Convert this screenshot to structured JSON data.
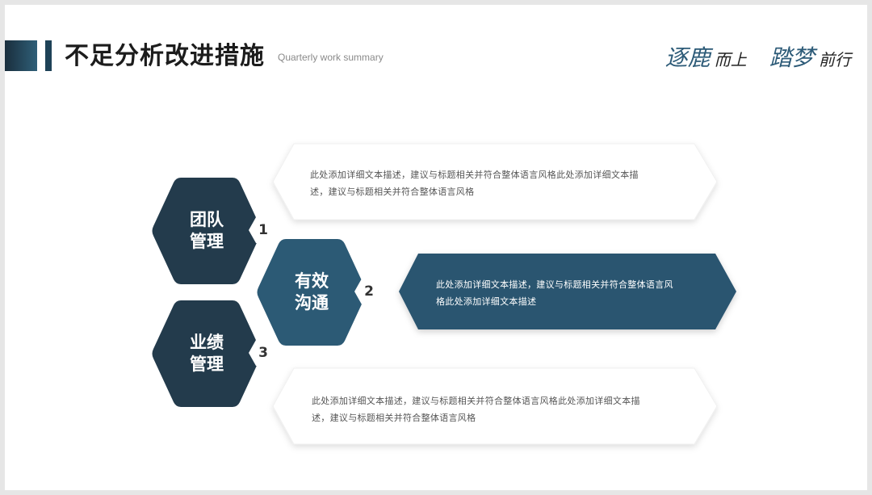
{
  "header": {
    "title": "不足分析改进措施",
    "subtitle": "Quarterly work summary",
    "slogan": {
      "part1_big": "逐鹿",
      "part1_small": "而上",
      "part2_big": "踏梦",
      "part2_small": "前行"
    }
  },
  "colors": {
    "dark_hex": "#233b4c",
    "mid_hex": "#2c5a75",
    "card_dark": "#2c5470",
    "card_light": "#ffffff",
    "accent": "#2d5b78"
  },
  "items": [
    {
      "number": "1",
      "label_line1": "团队",
      "label_line2": "管理",
      "text_line1": "此处添加详细文本描述，建议与标题相关并符合整体语言风格此处添加详细文本描",
      "text_line2": "述，建议与标题相关并符合整体语言风格"
    },
    {
      "number": "2",
      "label_line1": "有效",
      "label_line2": "沟通",
      "text_line1": "此处添加详细文本描述，建议与标题相关并符合整体语言风",
      "text_line2": "格此处添加详细文本描述"
    },
    {
      "number": "3",
      "label_line1": "业绩",
      "label_line2": "管理",
      "text_line1": "此处添加详细文本描述，建议与标题相关并符合整体语言风格此处添加详细文本描",
      "text_line2": "述，建议与标题相关并符合整体语言风格"
    }
  ]
}
